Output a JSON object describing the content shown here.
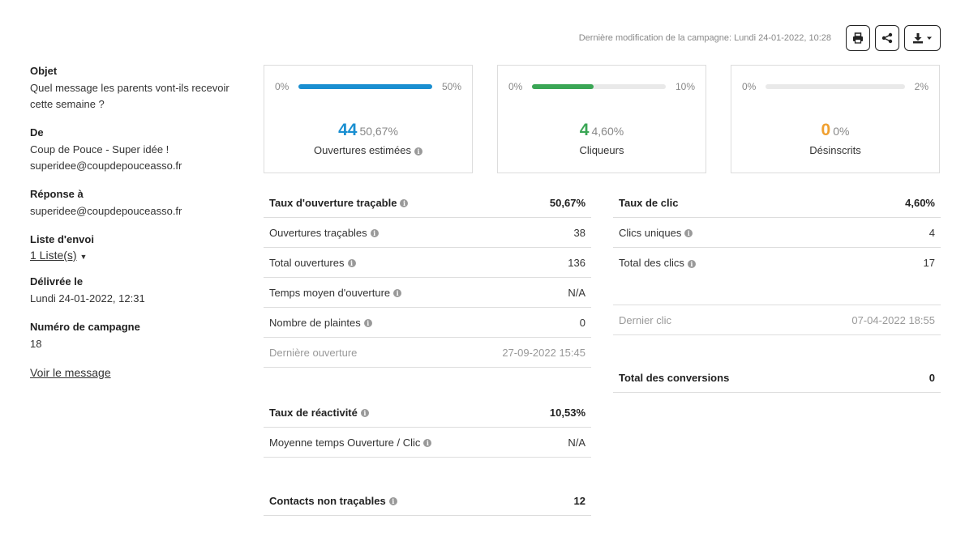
{
  "header": {
    "last_modified": "Dernière modification de la campagne:  Lundi 24-01-2022, 10:28"
  },
  "left": {
    "subject_label": "Objet",
    "subject": "Quel message les parents vont-ils recevoir cette semaine ?",
    "from_label": "De",
    "from_name": "Coup de Pouce - Super idée !",
    "from_email": "superidee@coupdepouceasso.fr",
    "reply_label": "Réponse à",
    "reply_email": "superidee@coupdepouceasso.fr",
    "list_label": "Liste d'envoi",
    "list_value": "1 Liste(s)",
    "delivered_label": "Délivrée le",
    "delivered_value": "Lundi 24-01-2022, 12:31",
    "campaign_label": "Numéro de campagne",
    "campaign_value": "18",
    "view_message": "Voir le message"
  },
  "stats": [
    {
      "min": "0%",
      "max": "50%",
      "fraction": 1.0,
      "color": "#1a8fd1",
      "count": "44",
      "pct": "50,67%",
      "label": "Ouvertures estimées"
    },
    {
      "min": "0%",
      "max": "10%",
      "fraction": 0.46,
      "color": "#3aa655",
      "count": "4",
      "pct": "4,60%",
      "label": "Cliqueurs"
    },
    {
      "min": "0%",
      "max": "2%",
      "fraction": 0,
      "color": "#f0a030",
      "count": "0",
      "pct": "0%",
      "label": "Désinscrits"
    }
  ],
  "opens": {
    "rate": {
      "label": "Taux d'ouverture traçable",
      "value": "50,67%"
    },
    "tracked": {
      "label": "Ouvertures traçables",
      "value": "38"
    },
    "total": {
      "label": "Total ouvertures",
      "value": "136"
    },
    "avgtime": {
      "label": "Temps moyen d'ouverture",
      "value": "N/A"
    },
    "complaints": {
      "label": "Nombre de plaintes",
      "value": "0"
    },
    "last": {
      "label": "Dernière ouverture",
      "value": "27-09-2022 15:45"
    },
    "reactivity": {
      "label": "Taux de réactivité",
      "value": "10,53%"
    },
    "avg_open_click": {
      "label": "Moyenne temps Ouverture / Clic",
      "value": "N/A"
    },
    "untracked": {
      "label": "Contacts non traçables",
      "value": "12"
    }
  },
  "clicks": {
    "rate": {
      "label": "Taux de clic",
      "value": "4,60%"
    },
    "unique": {
      "label": "Clics uniques",
      "value": "4"
    },
    "total": {
      "label": "Total des clics",
      "value": "17"
    },
    "last": {
      "label": "Dernier clic",
      "value": "07-04-2022 18:55"
    },
    "conversions": {
      "label": "Total des conversions",
      "value": "0"
    }
  },
  "icons": {
    "print": "printer-icon",
    "share": "share-icon",
    "download": "download-icon",
    "info": "info-icon"
  }
}
